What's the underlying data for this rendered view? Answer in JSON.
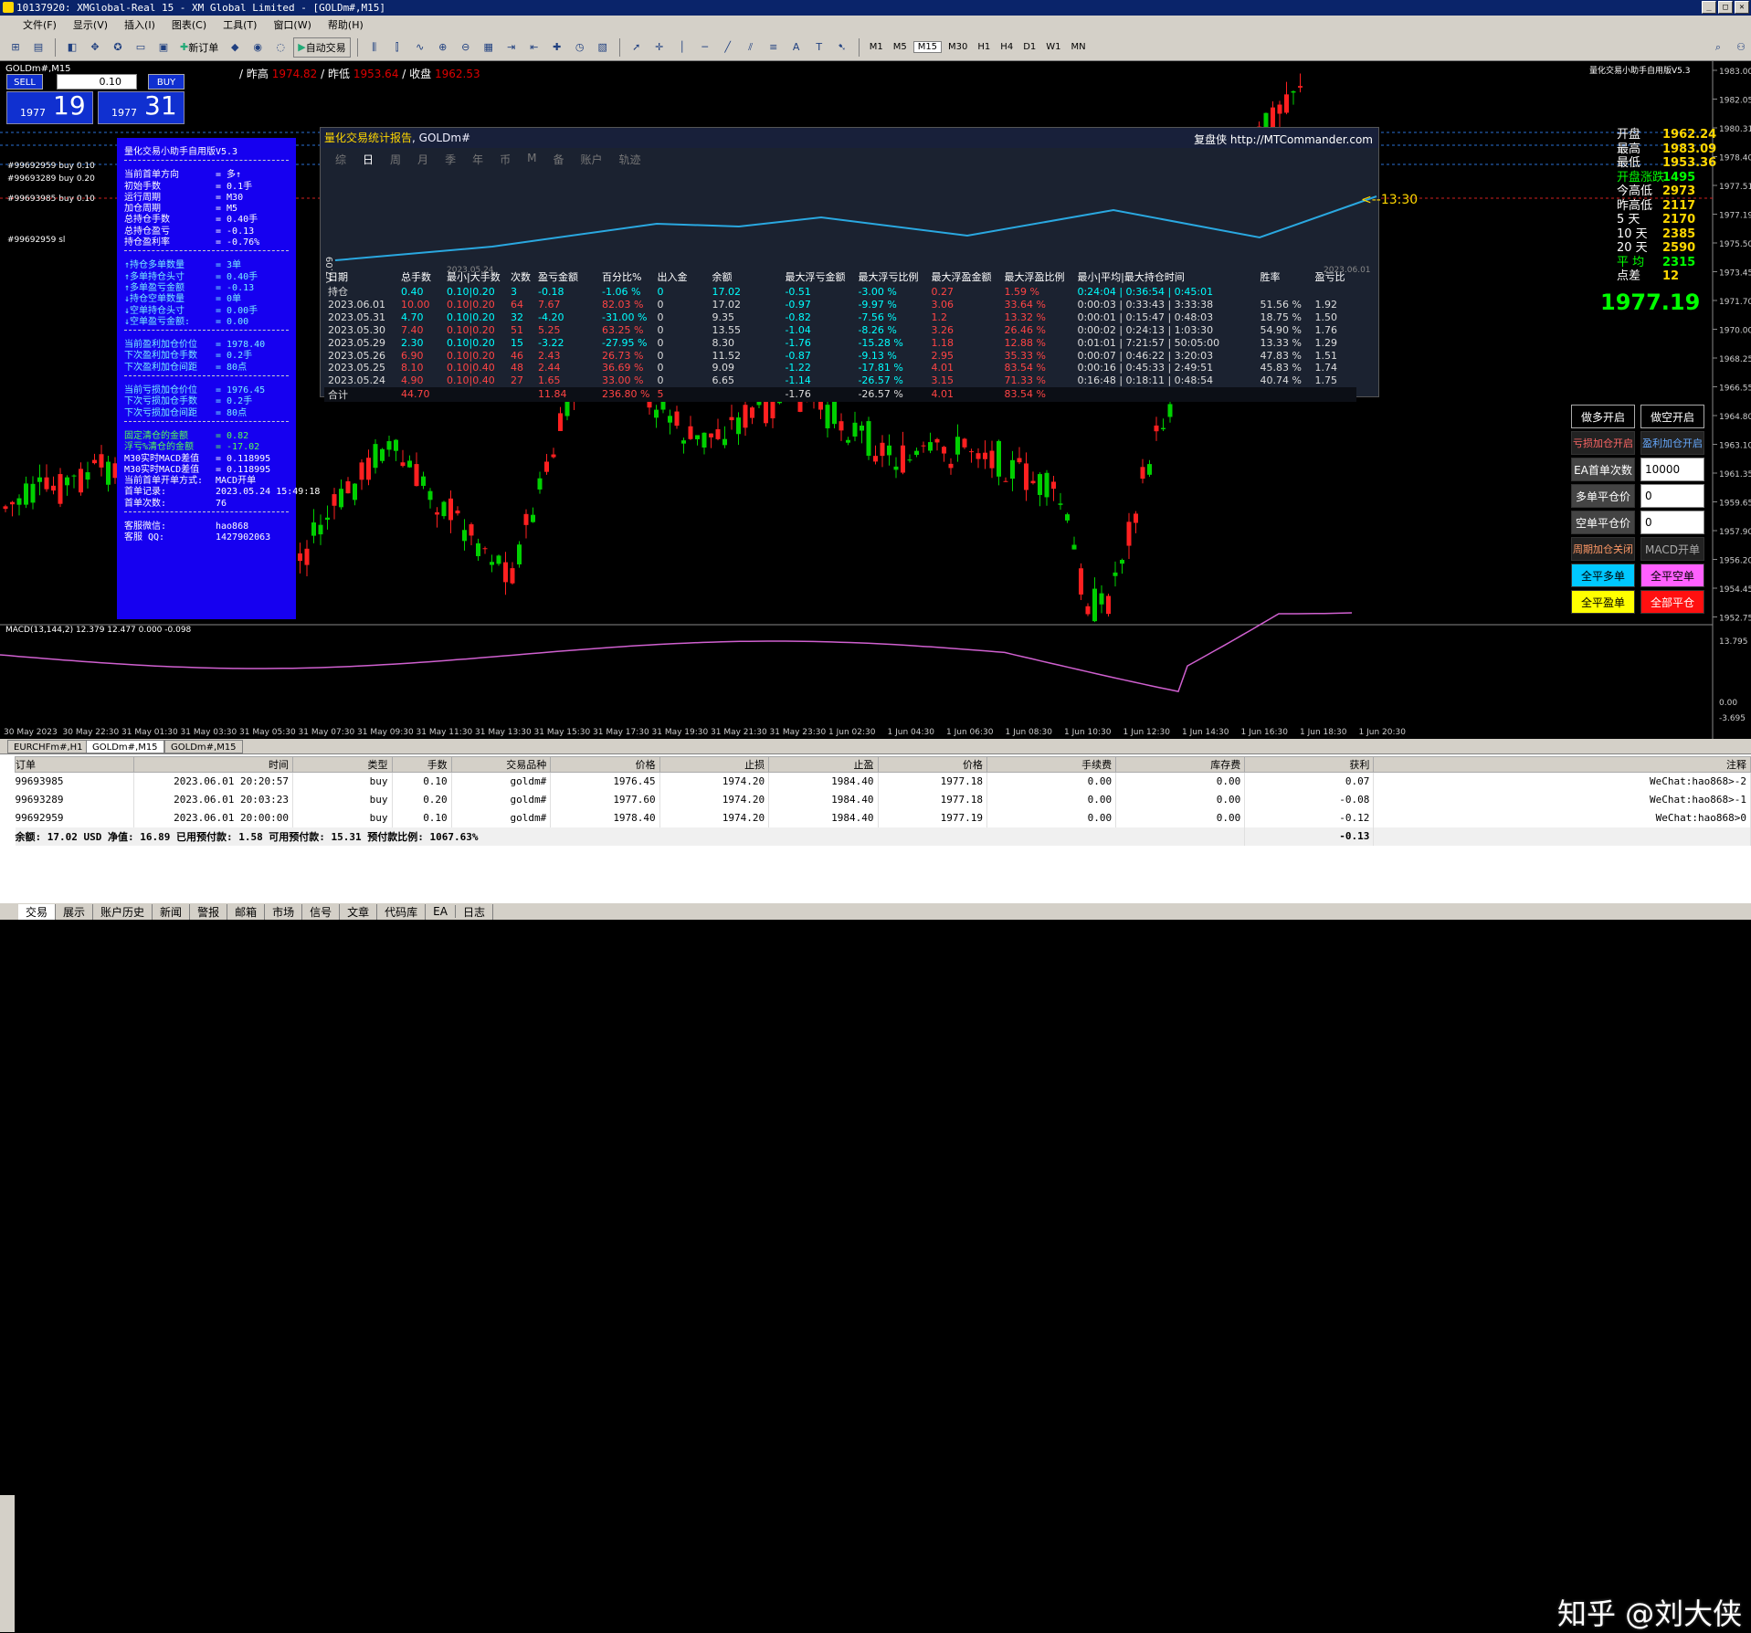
{
  "titlebar": {
    "text": "10137920: XMGlobal-Real 15 - XM Global Limited - [GOLDm#,M15]",
    "min": "_",
    "max": "□",
    "close": "✕"
  },
  "menu": [
    "文件(F)",
    "显示(V)",
    "插入(I)",
    "图表(C)",
    "工具(T)",
    "窗口(W)",
    "帮助(H)"
  ],
  "toolbar": {
    "new_order": "新订单",
    "auto_trade": "自动交易",
    "timeframes": [
      "M1",
      "M5",
      "M15",
      "M30",
      "H1",
      "H4",
      "D1",
      "W1",
      "MN"
    ]
  },
  "chart": {
    "title": "GOLDm#,M15",
    "prev_high_label": "/ 昨高",
    "prev_high": "1974.82",
    "prev_low_label": "/ 昨低",
    "prev_low": "1953.64",
    "prev_close_label": "/ 收盘",
    "prev_close": "1962.53",
    "ea_name": "量化交易小助手自用版V5.3",
    "price_ticks": [
      "1983.00",
      "1982.05",
      "1980.31",
      "1978.40",
      "1977.51",
      "1977.19",
      "1975.50",
      "1973.45",
      "1971.70",
      "1970.00",
      "1968.25",
      "1966.55",
      "1964.80",
      "1963.10",
      "1961.35",
      "1959.65",
      "1957.90",
      "1956.20",
      "1954.45",
      "1952.75"
    ],
    "time_ticks": [
      "30 May 2023",
      "30 May 22:30",
      "31 May 01:30",
      "31 May 03:30",
      "31 May 05:30",
      "31 May 07:30",
      "31 May 09:30",
      "31 May 11:30",
      "31 May 13:30",
      "31 May 15:30",
      "31 May 17:30",
      "31 May 19:30",
      "31 May 21:30",
      "31 May 23:30",
      "1 Jun 02:30",
      "1 Jun 04:30",
      "1 Jun 06:30",
      "1 Jun 08:30",
      "1 Jun 10:30",
      "1 Jun 12:30",
      "1 Jun 14:30",
      "1 Jun 16:30",
      "1 Jun 18:30",
      "1 Jun 20:30"
    ],
    "macd_label": "MACD(13,144,2) 12.379 12.477 0.000 -0.098",
    "macd_ticks": [
      "13.795",
      "0.00",
      "-3.695"
    ],
    "timer": "<--13:30",
    "order_labels": [
      "#99692959 buy 0.10",
      "#99693289 buy 0.20",
      "#99693985 buy 0.10",
      "#99692959 sl"
    ]
  },
  "tradebox": {
    "sell": "SELL",
    "buy": "BUY",
    "lot": "0.10",
    "bid_small": "1977",
    "bid_big": "19",
    "ask_small": "1977",
    "ask_big": "31"
  },
  "ea": {
    "title": "量化交易小助手自用版V5.3",
    "block1": [
      [
        "当前首单方向",
        "= 多↑"
      ],
      [
        "初始手数",
        "= 0.1手"
      ],
      [
        "运行周期",
        "= M30"
      ],
      [
        "加仓周期",
        "= M5"
      ],
      [
        "总持仓手数",
        "= 0.40手"
      ],
      [
        "总持仓盈亏",
        "= -0.13"
      ],
      [
        "持仓盈利率",
        "= -0.76%"
      ]
    ],
    "block2": [
      [
        "↑持仓多单数量",
        "= 3单"
      ],
      [
        "↑多单持仓头寸",
        "= 0.40手"
      ],
      [
        "↑多单盈亏金额",
        "= -0.13"
      ],
      [
        "↓持仓空单数量",
        "= 0单"
      ],
      [
        "↓空单持仓头寸",
        "= 0.00手"
      ],
      [
        "↓空单盈亏金额:",
        "= 0.00"
      ]
    ],
    "block3": [
      [
        "当前盈利加仓价位",
        "= 1978.40"
      ],
      [
        "下次盈利加仓手数",
        "= 0.2手"
      ],
      [
        "下次盈利加仓间距",
        "= 80点"
      ]
    ],
    "block4": [
      [
        "当前亏损加仓价位",
        "= 1976.45"
      ],
      [
        "下次亏损加仓手数",
        "= 0.2手"
      ],
      [
        "下次亏损加仓间距",
        "= 80点"
      ]
    ],
    "block5": [
      [
        "固定清仓的金额",
        "= 0.82"
      ],
      [
        "浮亏%清仓的金额",
        "= -17.02"
      ],
      [
        "M30实时MACD差值",
        "= 0.118995"
      ],
      [
        "M30实时MACD差值",
        "= 0.118995"
      ],
      [
        "当前首单开单方式:",
        "MACD开单"
      ],
      [
        "首单记录:",
        "2023.05.24 15:49:18"
      ],
      [
        "首单次数:",
        "76"
      ]
    ],
    "contact": [
      [
        "客服微信:",
        "hao868"
      ],
      [
        "客服 QQ:",
        "1427902063"
      ]
    ]
  },
  "report": {
    "title": "量化交易统计报告",
    "symbol": ", GOLDm#",
    "right_brand": "复盘侠",
    "right_url": "http://MTCommander.com",
    "tabs": [
      "综",
      "日",
      "周",
      "月",
      "季",
      "年",
      "币",
      "M",
      "备",
      "账户",
      "轨迹"
    ],
    "active_tab": "日",
    "x_start": "2023.05.24",
    "x_end": "2023.06.01",
    "ylabel": "V7.09",
    "headers": [
      "日期",
      "总手数",
      "最小|大手数",
      "次数",
      "盈亏金额",
      "百分比%",
      "出入金",
      "余额",
      "最大浮亏金额",
      "最大浮亏比例",
      "最大浮盈金额",
      "最大浮盈比例",
      "最小|平均|最大持仓时间",
      "胜率",
      "盈亏比"
    ],
    "rows": [
      [
        "持仓",
        "0.40",
        "0.10|0.20",
        "3",
        "-0.18",
        "-1.06 %",
        "0",
        "17.02",
        "-0.51",
        "-3.00 %",
        "0.27",
        "1.59 %",
        "0:24:04 | 0:36:54 | 0:45:01",
        "",
        ""
      ],
      [
        "2023.06.01",
        "10.00",
        "0.10|0.20",
        "64",
        "7.67",
        "82.03 %",
        "0",
        "17.02",
        "-0.97",
        "-9.97 %",
        "3.06",
        "33.64 %",
        "0:00:03 | 0:33:43 | 3:33:38",
        "51.56 %",
        "1.92"
      ],
      [
        "2023.05.31",
        "4.70",
        "0.10|0.20",
        "32",
        "-4.20",
        "-31.00 %",
        "0",
        "9.35",
        "-0.82",
        "-7.56 %",
        "1.2",
        "13.32 %",
        "0:00:01 | 0:15:47 | 0:48:03",
        "18.75 %",
        "1.50"
      ],
      [
        "2023.05.30",
        "7.40",
        "0.10|0.20",
        "51",
        "5.25",
        "63.25 %",
        "0",
        "13.55",
        "-1.04",
        "-8.26 %",
        "3.26",
        "26.46 %",
        "0:00:02 | 0:24:13 | 1:03:30",
        "54.90 %",
        "1.76"
      ],
      [
        "2023.05.29",
        "2.30",
        "0.10|0.20",
        "15",
        "-3.22",
        "-27.95 %",
        "0",
        "8.30",
        "-1.76",
        "-15.28 %",
        "1.18",
        "12.88 %",
        "0:01:01 | 7:21:57 | 50:05:00",
        "13.33 %",
        "1.29"
      ],
      [
        "2023.05.26",
        "6.90",
        "0.10|0.20",
        "46",
        "2.43",
        "26.73 %",
        "0",
        "11.52",
        "-0.87",
        "-9.13 %",
        "2.95",
        "35.33 %",
        "0:00:07 | 0:46:22 | 3:20:03",
        "47.83 %",
        "1.51"
      ],
      [
        "2023.05.25",
        "8.10",
        "0.10|0.40",
        "48",
        "2.44",
        "36.69 %",
        "0",
        "9.09",
        "-1.22",
        "-17.81 %",
        "4.01",
        "83.54 %",
        "0:00:16 | 0:45:33 | 2:49:51",
        "45.83 %",
        "1.74"
      ],
      [
        "2023.05.24",
        "4.90",
        "0.10|0.40",
        "27",
        "1.65",
        "33.00 %",
        "0",
        "6.65",
        "-1.14",
        "-26.57 %",
        "3.15",
        "71.33 %",
        "0:16:48 | 0:18:11 | 0:48:54",
        "40.74 %",
        "1.75"
      ],
      [
        "合计",
        "44.70",
        "",
        "",
        "11.84",
        "236.80 %",
        "5",
        "",
        "-1.76",
        "-26.57 %",
        "4.01",
        "83.54 %",
        "",
        "",
        ""
      ]
    ]
  },
  "price_panel": [
    [
      "开盘",
      "1962.24",
      "#fff",
      "#ffd700"
    ],
    [
      "最高",
      "1983.09",
      "#fff",
      "#ffd700"
    ],
    [
      "最低",
      "1953.36",
      "#fff",
      "#ffd700"
    ],
    [
      "开盘涨跌",
      "1495",
      "#0f0",
      "#0f0"
    ],
    [
      "今高低",
      "2973",
      "#fff",
      "#ffd700"
    ],
    [
      "昨高低",
      "2117",
      "#fff",
      "#ffd700"
    ],
    [
      "5  天",
      "2170",
      "#fff",
      "#ffd700"
    ],
    [
      "10 天",
      "2385",
      "#fff",
      "#ffd700"
    ],
    [
      "20 天",
      "2590",
      "#fff",
      "#ffd700"
    ],
    [
      "平  均",
      "2315",
      "#0f0",
      "#0f0"
    ],
    [
      "点差",
      "12",
      "#fff",
      "#ffd700"
    ]
  ],
  "big_price": "1977.19",
  "controls": {
    "btn_long": "做多开启",
    "btn_short": "做空开启",
    "btn_loss_add": "亏损加仓开启",
    "btn_profit_add": "盈利加仓开启",
    "lbl_first": "EA首单次数",
    "val_first": "10000",
    "lbl_long_avg": "多单平仓价",
    "val_long_avg": "0",
    "lbl_short_avg": "空单平仓价",
    "val_short_avg": "0",
    "btn_period": "周期加仓关闭",
    "btn_macd": "MACD开单",
    "btn_close_long": "全平多单",
    "btn_close_short": "全平空单",
    "btn_close_profit": "全平盈单",
    "btn_close_all": "全部平仓"
  },
  "chart_tabs": [
    "EURCHFm#,H1",
    "GOLDm#,M15",
    "GOLDm#,M15"
  ],
  "orders": {
    "headers": [
      "订单",
      "时间",
      "类型",
      "手数",
      "交易品种",
      "价格",
      "止损",
      "止盈",
      "价格",
      "手续费",
      "库存费",
      "获利",
      "注释"
    ],
    "rows": [
      [
        "99693985",
        "2023.06.01 20:20:57",
        "buy",
        "0.10",
        "goldm#",
        "1976.45",
        "1974.20",
        "1984.40",
        "1977.18",
        "0.00",
        "0.00",
        "0.07",
        "WeChat:hao868>-2"
      ],
      [
        "99693289",
        "2023.06.01 20:03:23",
        "buy",
        "0.20",
        "goldm#",
        "1977.60",
        "1974.20",
        "1984.40",
        "1977.18",
        "0.00",
        "0.00",
        "-0.08",
        "WeChat:hao868>-1"
      ],
      [
        "99692959",
        "2023.06.01 20:00:00",
        "buy",
        "0.10",
        "goldm#",
        "1978.40",
        "1974.20",
        "1984.40",
        "1977.19",
        "0.00",
        "0.00",
        "-0.12",
        "WeChat:hao868>0"
      ]
    ],
    "balance_line": "余额: 17.02 USD  净值: 16.89  已用预付款: 1.58  可用预付款: 15.31  预付款比例: 1067.63%",
    "balance_profit": "-0.13"
  },
  "bottom_tabs": [
    "交易",
    "展示",
    "账户历史",
    "新闻",
    "警报",
    "邮箱",
    "市场",
    "信号",
    "文章",
    "代码库",
    "EA",
    "日志"
  ],
  "watermark": "知乎 @刘大侠"
}
